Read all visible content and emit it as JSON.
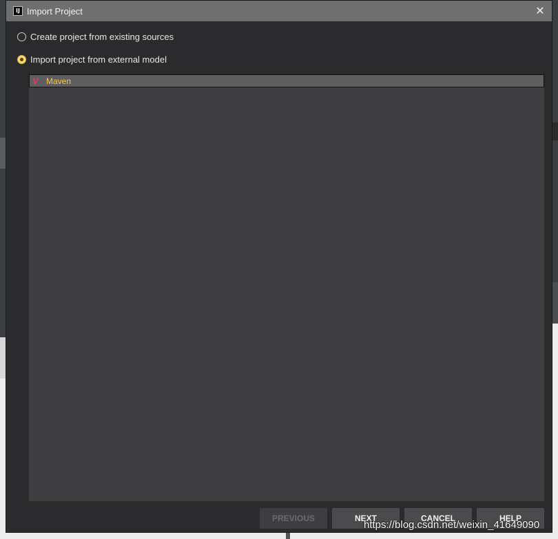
{
  "window": {
    "title": "Import Project",
    "app_icon_text": "IJ",
    "close_glyph": "✕"
  },
  "options": [
    {
      "label": "Create project from existing sources",
      "selected": false
    },
    {
      "label": "Import project from external model",
      "selected": true
    }
  ],
  "models": [
    {
      "icon": "maven-icon",
      "icon_glyph": "V",
      "label": "Maven",
      "selected": true
    }
  ],
  "buttons": {
    "previous": "PREVIOUS",
    "next": "NEXT",
    "cancel": "CANCEL",
    "help": "HELP"
  },
  "watermark": "https://blog.csdn.net/weixin_41649090",
  "colors": {
    "radio_selected": "#f7d96a",
    "maven_icon": "#e8365d",
    "maven_label": "#f6c74a"
  }
}
